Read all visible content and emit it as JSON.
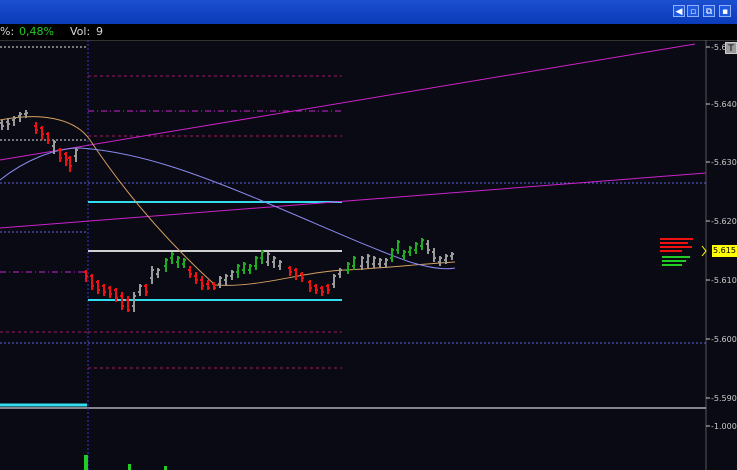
{
  "window": {
    "buttons": [
      {
        "name": "back-button",
        "glyph": "◀"
      },
      {
        "name": "restore-button",
        "glyph": "▫"
      },
      {
        "name": "maximize-button",
        "glyph": "⧉"
      },
      {
        "name": "close-button",
        "glyph": "▪"
      }
    ]
  },
  "infobar": {
    "change_prefix": "%:",
    "change_value": "0,48%",
    "volume_label": "Vol:",
    "volume_value": "9"
  },
  "price_axis": {
    "labels": [
      "-5.6",
      "-5.640",
      "-5.630",
      "-5.620",
      "-5.610",
      "-5.600",
      "-5.590"
    ],
    "current_price": "5.615",
    "scale_button": "T"
  },
  "volume_axis": {
    "labels": [
      "-1.000"
    ]
  },
  "colors": {
    "background": "#0a0a14",
    "up_bar": "#22aa22",
    "down_bar": "#ee1111",
    "neutral_bar": "#9a9a9a",
    "magenta": "#cc22cc",
    "cyan": "#33ddee",
    "white_line": "#d0d0d0",
    "ma_fast": "#d6a060",
    "ma_slow": "#8a8af0",
    "current_price_tag": "#ffff00"
  }
}
